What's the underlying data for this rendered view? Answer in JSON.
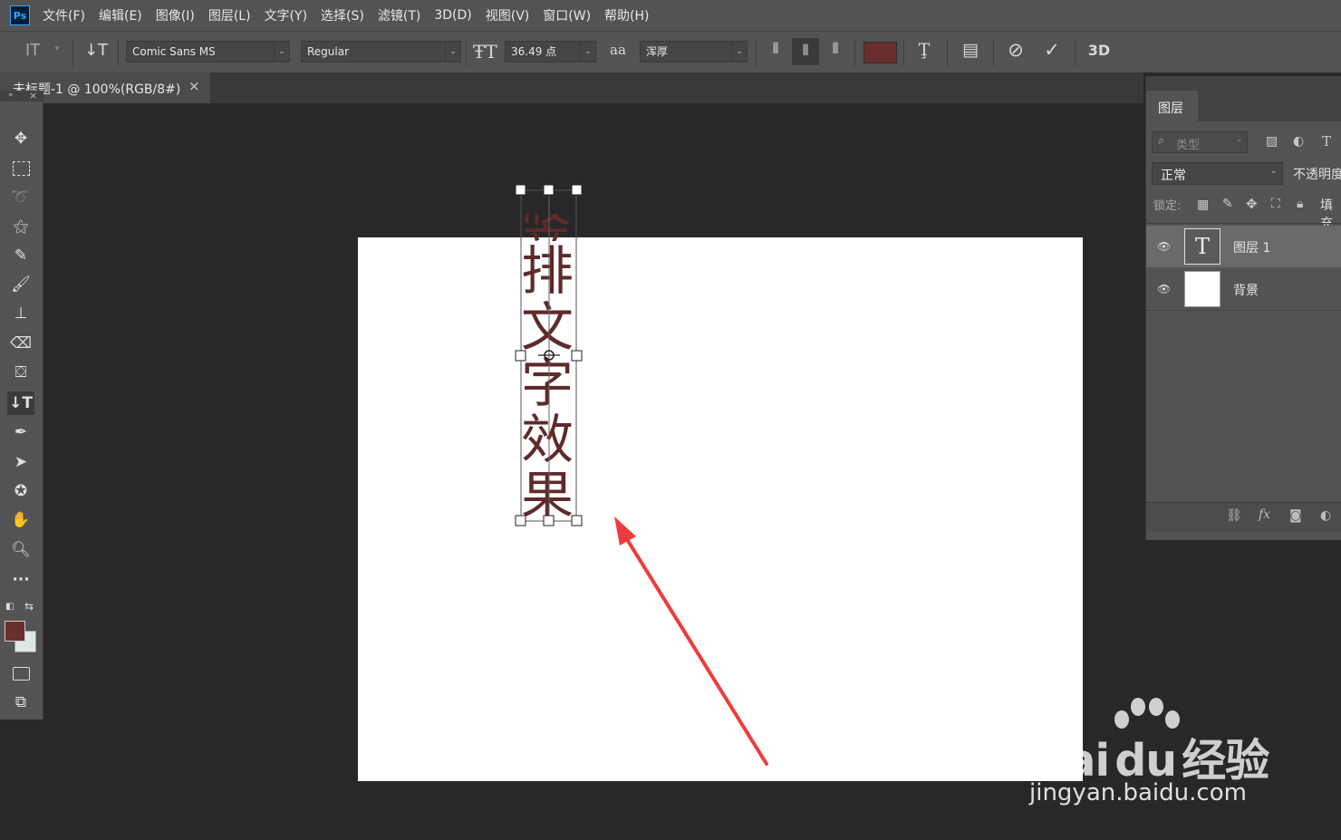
{
  "menubar": {
    "logo": "Ps",
    "items": [
      "文件(F)",
      "编辑(E)",
      "图像(I)",
      "图层(L)",
      "文字(Y)",
      "选择(S)",
      "滤镜(T)",
      "3D(D)",
      "视图(V)",
      "窗口(W)",
      "帮助(H)"
    ]
  },
  "options": {
    "font_family": "Comic Sans MS",
    "font_style": "Regular",
    "font_size": "36.49 点",
    "aa_label": "aa",
    "antialias": "浑厚",
    "text_color": "#6b2e2e",
    "label_3d": "3D"
  },
  "document": {
    "tab_title": "未标题-1 @ 100%(RGB/8#)",
    "tab_close": "×",
    "text_chars": [
      "排",
      "文",
      "字",
      "效",
      "果"
    ],
    "text_color": "#5e2a2a"
  },
  "toolbar": {
    "foreground_color": "#6b2e2e",
    "background_color": "#dfe6e6"
  },
  "layers_panel": {
    "tab_label": "图层",
    "filter_placeholder": "类型",
    "blend_mode": "正常",
    "opacity_label": "不透明度",
    "lock_label": "锁定:",
    "fill_label": "填充",
    "layers": [
      {
        "name": "图层 1",
        "thumb": "T",
        "selected": true
      },
      {
        "name": "背景",
        "thumb": "",
        "selected": false
      }
    ],
    "fx_label": "fx"
  },
  "watermark": {
    "brand": "Bai",
    "brand_suffix": "du",
    "brand_cn": "经验",
    "url": "jingyan.baidu.com"
  }
}
